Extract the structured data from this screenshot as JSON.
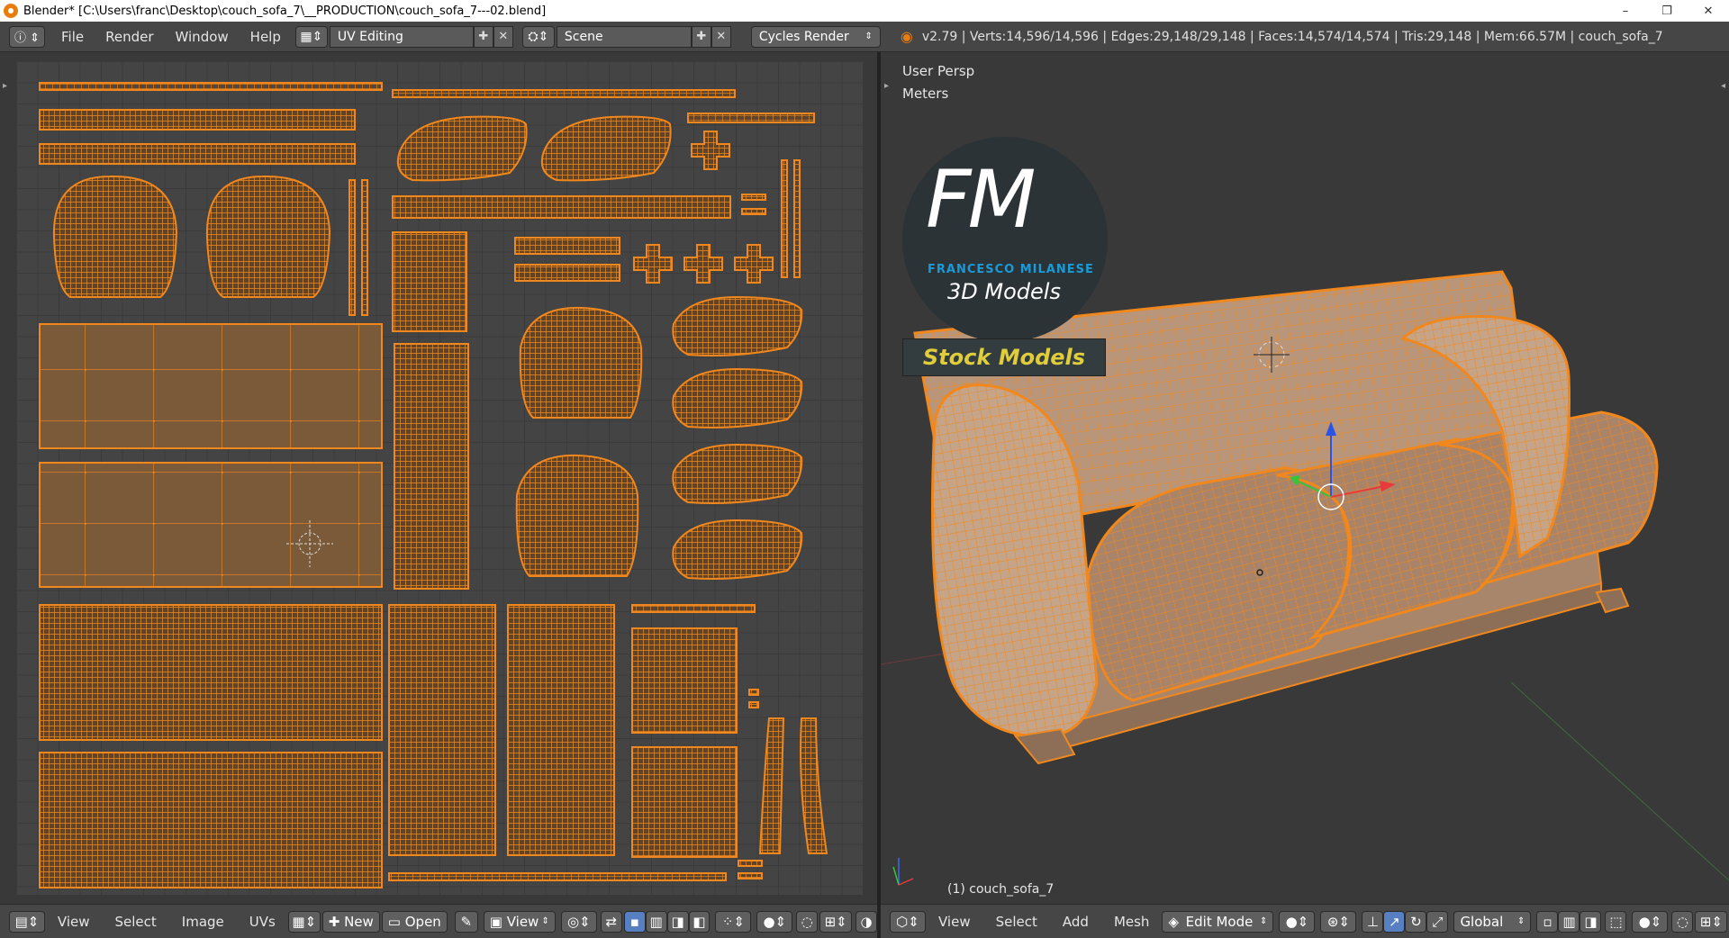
{
  "window": {
    "title": "Blender* [C:\\Users\\franc\\Desktop\\couch_sofa_7\\__PRODUCTION\\couch_sofa_7---02.blend]",
    "controls": [
      "–",
      "❐",
      "✕"
    ]
  },
  "infobar": {
    "menus": [
      "File",
      "Render",
      "Window",
      "Help"
    ],
    "screen_layout": "UV Editing",
    "scene": "Scene",
    "render_engine": "Cycles Render",
    "stats": "v2.79 | Verts:14,596/14,596 | Edges:29,148/29,148 | Faces:14,574/14,574 | Tris:29,148 | Mem:66.57M | couch_sofa_7"
  },
  "uv_editor": {
    "footer_menus": [
      "View",
      "Select",
      "Image",
      "UVs"
    ],
    "new_label": "New",
    "open_label": "Open",
    "view_label": "View"
  },
  "viewport": {
    "view_label": "User Persp",
    "units_label": "Meters",
    "object_label": "(1) couch_sofa_7",
    "footer_menus": [
      "View",
      "Select",
      "Add",
      "Mesh"
    ],
    "mode": "Edit Mode",
    "orientation": "Global"
  },
  "watermark": {
    "logo_text": "FM",
    "brand": "FRANCESCO MILANESE",
    "sub": "3D Models",
    "banner": "Stock Models"
  },
  "colors": {
    "uv_wire": "#f0881e",
    "uv_fill": "#7a5a38",
    "header_bg": "#464646",
    "editor_bg": "#393939",
    "accent_blue": "#1a9bd7"
  }
}
